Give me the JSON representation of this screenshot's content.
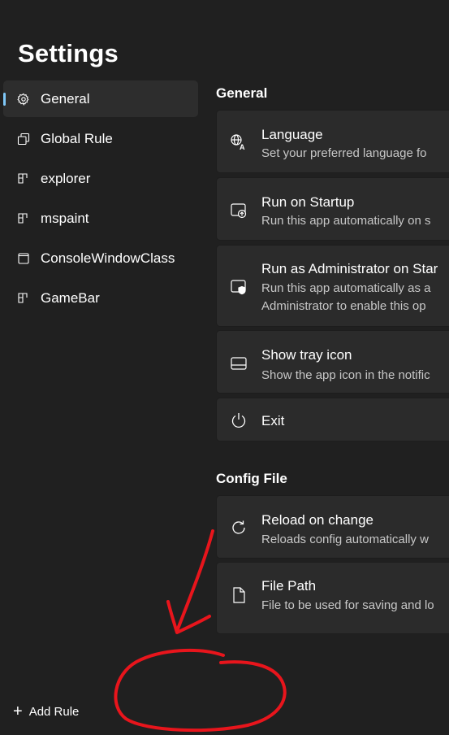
{
  "app": {
    "title": "Settings"
  },
  "sidebar": {
    "items": [
      {
        "label": "General",
        "icon": "gear-icon",
        "selected": true
      },
      {
        "label": "Global Rule",
        "icon": "copy-windows-icon"
      },
      {
        "label": "explorer",
        "icon": "app-window-icon"
      },
      {
        "label": "mspaint",
        "icon": "app-window-icon"
      },
      {
        "label": "ConsoleWindowClass",
        "icon": "window-icon"
      },
      {
        "label": "GameBar",
        "icon": "app-window-icon"
      }
    ],
    "add_rule_label": "Add Rule"
  },
  "general": {
    "title": "General",
    "cards": [
      {
        "title": "Language",
        "desc": "Set your preferred language fo",
        "icon": "language-icon"
      },
      {
        "title": "Run on Startup",
        "desc": "Run this app automatically on s",
        "icon": "startup-icon"
      },
      {
        "title": "Run as Administrator on Star",
        "desc": "Run this app automatically as a",
        "desc2": "Administrator to enable this op",
        "icon": "admin-shield-icon"
      },
      {
        "title": "Show tray icon",
        "desc": "Show the app icon in the notific",
        "icon": "tray-icon"
      },
      {
        "title": "Exit",
        "icon": "power-icon"
      }
    ]
  },
  "config": {
    "title": "Config File",
    "cards": [
      {
        "title": "Reload on change",
        "desc": "Reloads config automatically w",
        "icon": "refresh-icon"
      },
      {
        "title": "File Path",
        "desc": "File to be used for saving and lo",
        "icon": "document-icon"
      }
    ]
  },
  "colors": {
    "background": "#202020",
    "card": "#2b2b2b",
    "selected": "#2d2d2d",
    "accent": "#7fc8f8",
    "annotation": "#e8151c"
  }
}
